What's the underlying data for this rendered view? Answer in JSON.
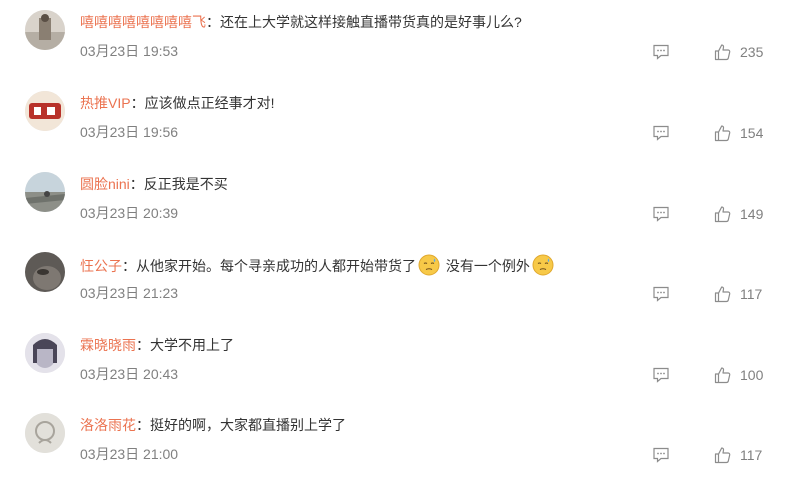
{
  "comments": [
    {
      "username": "嘻嘻嘻嘻嘻嘻嘻嘻飞",
      "colon": "：",
      "text": "还在上大学就这样接触直播带货真的是好事儿么?",
      "text2": "",
      "emojis": 0,
      "date": "03月23日 19:53",
      "likes": "235",
      "avatar_color": "#c9c2b8"
    },
    {
      "username": "热推VIP",
      "colon": "：",
      "text": "应该做点正经事才对!",
      "text2": "",
      "emojis": 0,
      "date": "03月23日 19:56",
      "likes": "154",
      "avatar_color": "#b8322a"
    },
    {
      "username": "圆脸nini",
      "colon": "：",
      "text": "反正我是不买",
      "text2": "",
      "emojis": 0,
      "date": "03月23日 20:39",
      "likes": "149",
      "avatar_color": "#9aa4a8"
    },
    {
      "username": "忹公子",
      "colon": "：",
      "text": "从他家开始。每个寻亲成功的人都开始带货了",
      "text2": "没有一个例外",
      "emojis": 2,
      "date": "03月23日 21:23",
      "likes": "117",
      "avatar_color": "#6e6a66"
    },
    {
      "username": "霖晓晓雨",
      "colon": "：",
      "text": "大学不用上了",
      "text2": "",
      "emojis": 0,
      "date": "03月23日 20:43",
      "likes": "100",
      "avatar_color": "#c8c4d2"
    },
    {
      "username": "洛洛雨花",
      "colon": "：",
      "text": "挺好的啊，大家都直播别上学了",
      "text2": "",
      "emojis": 0,
      "date": "03月23日 21:00",
      "likes": "117",
      "avatar_color": "#d8d6d0"
    }
  ],
  "colors": {
    "username": "#eb7350",
    "meta": "#808080",
    "text": "#333333"
  }
}
